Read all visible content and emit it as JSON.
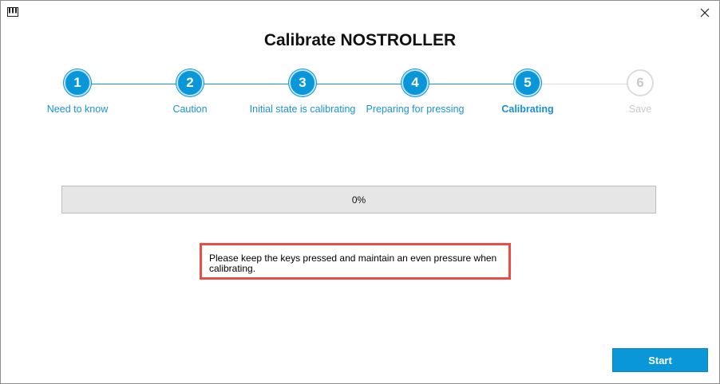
{
  "window": {
    "title": "Calibrate NOSTROLLER",
    "app_icon": "piano-keys-icon",
    "close_icon": "close-icon"
  },
  "stepper": {
    "steps": [
      {
        "number": "1",
        "label": "Need to know",
        "state": "done"
      },
      {
        "number": "2",
        "label": "Caution",
        "state": "done"
      },
      {
        "number": "3",
        "label": "Initial state is calibrating",
        "state": "done"
      },
      {
        "number": "4",
        "label": "Preparing for pressing",
        "state": "done"
      },
      {
        "number": "5",
        "label": "Calibrating",
        "state": "active"
      },
      {
        "number": "6",
        "label": "Save",
        "state": "pending"
      }
    ]
  },
  "progress": {
    "value": 0,
    "label": "0%"
  },
  "notice": {
    "text": "Please keep the keys pressed and maintain an even pressure when calibrating."
  },
  "actions": {
    "start_label": "Start"
  },
  "colors": {
    "accent": "#0a97d9",
    "pending": "#c9c9c9",
    "highlight_border": "#ea4d43",
    "progress_track": "#e6e6e6"
  }
}
